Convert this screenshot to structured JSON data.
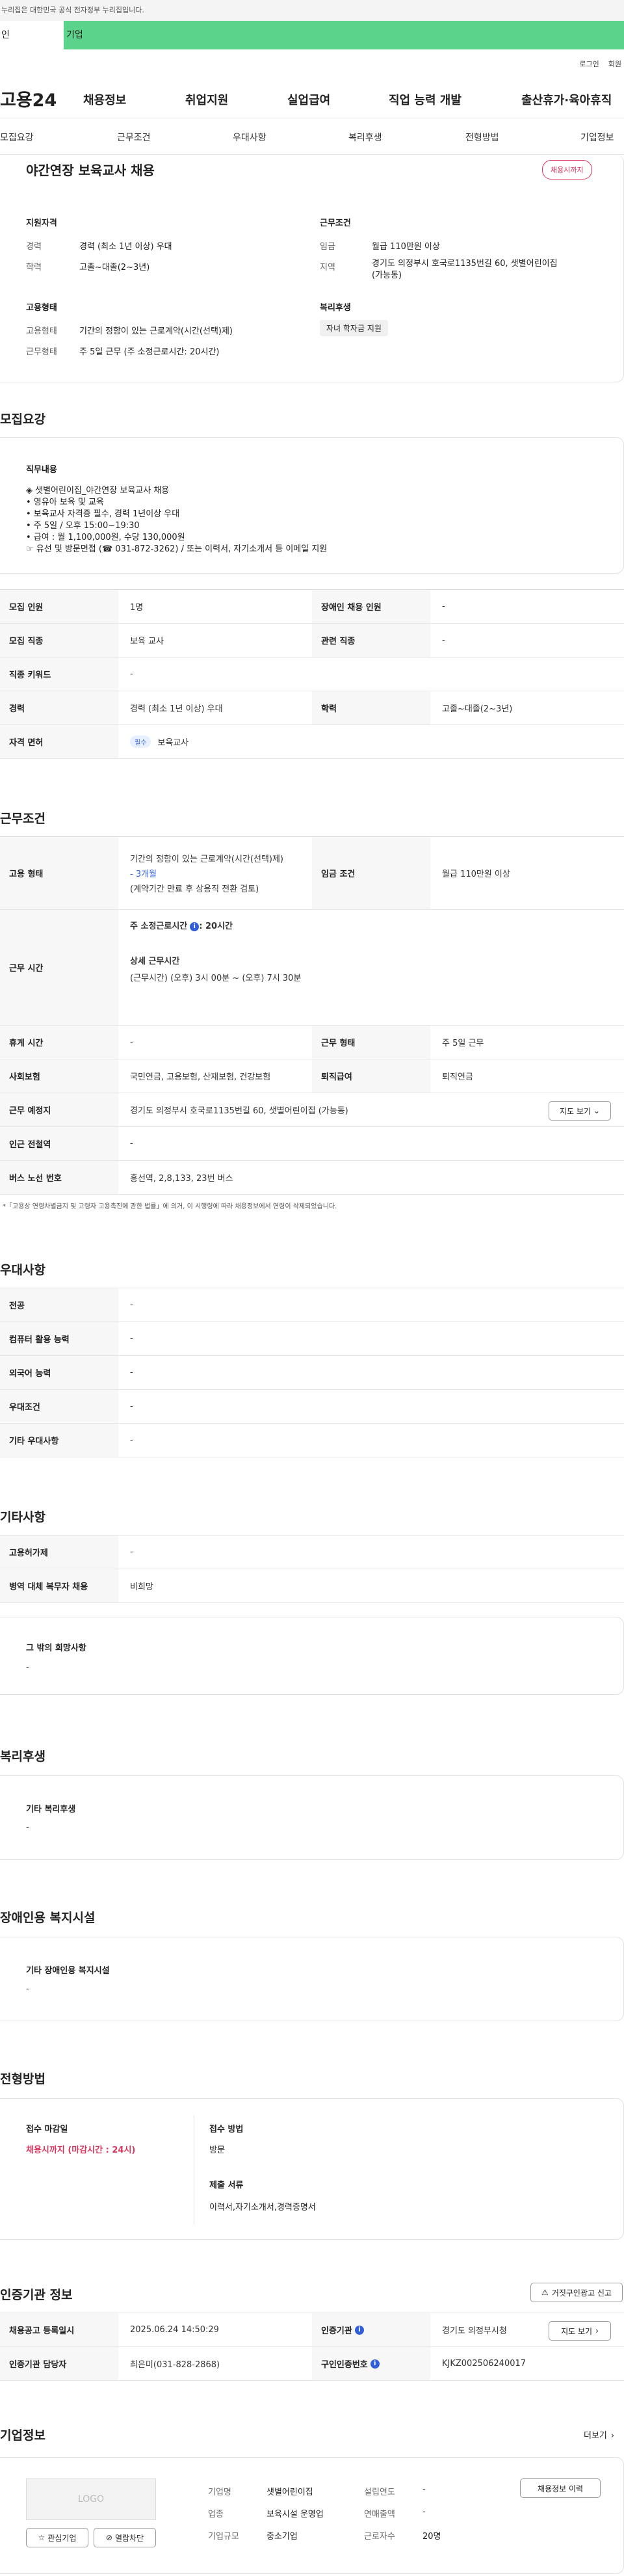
{
  "gov_notice": "누리집은 대한민국 공식 전자정부 누리집입니다.",
  "top_tabs": [
    "인",
    "기업"
  ],
  "util_links": [
    "로그인",
    "회원"
  ],
  "logo": "고용24",
  "gnb": [
    "채용정보",
    "취업지원",
    "실업급여",
    "직업 능력 개발",
    "출산휴가·육아휴직"
  ],
  "snb": [
    "모집요강",
    "근무조건",
    "우대사항",
    "복리후생",
    "전형방법",
    "기업정보"
  ],
  "summary": {
    "title": "야간연장 보육교사 채용",
    "deadline_badge": "채용시까지",
    "qual_heading": "지원자격",
    "qual": [
      {
        "k": "경력",
        "v": "경력 (최소 1년 이상) 우대"
      },
      {
        "k": "학력",
        "v": "고졸~대졸(2~3년)"
      }
    ],
    "cond_heading": "근무조건",
    "cond": [
      {
        "k": "임금",
        "v": "월급 110만원 이상"
      },
      {
        "k": "지역",
        "v": "경기도 의정부시 호국로1135번길 60, 샛별어린이집",
        "v2": "(가능동)"
      }
    ],
    "emp_heading": "고용형태",
    "emp": [
      {
        "k": "고용형태",
        "v": "기간의 정함이 있는 근로계약(시간(선택)제)"
      },
      {
        "k": "근무형태",
        "v": "주 5일 근무 (주 소정근로시간: 20시간)"
      }
    ],
    "welfare_heading": "복리후생",
    "welfare_tag": "자녀 학자금 지원"
  },
  "recruit": {
    "title": "모집요강",
    "duty_title": "직무내용",
    "duty_lines": [
      "◈ 샛별어린이집_야간연장 보육교사 채용",
      "• 영유아 보육 및 교육",
      "• 보육교사 자격증 필수, 경력 1년이상 우대",
      "• 주 5일 / 오후 15:00~19:30",
      "• 급여 : 월 1,100,000원, 수당 130,000원",
      "☞ 유선 및 방문면접 (☎ 031-872-3262) / 또는 이력서, 자기소개서 등 이메일 지원"
    ],
    "rows": [
      {
        "k1": "모집 인원",
        "v1": "1명",
        "k2": "장애인 채용 인원",
        "v2": "-"
      },
      {
        "k1": "모집 직종",
        "v1": "보육 교사",
        "k2": "관련 직종",
        "v2": "-"
      },
      {
        "k1": "직종 키워드",
        "v1": "-"
      },
      {
        "k1": "경력",
        "v1": "경력 (최소 1년 이상) 우대",
        "k2": "학력",
        "v2": "고졸~대졸(2~3년)"
      },
      {
        "k1": "자격 면허",
        "badge": "필수",
        "v1": "보육교사"
      }
    ]
  },
  "condition": {
    "title": "근무조건",
    "emp_k": "고용 형태",
    "emp_v1": "기간의 정함이 있는 근로계약(시간(선택)제)",
    "emp_v2": "- 3개월",
    "emp_v3": "(계약기간 만료 후 상용직 전환 검토)",
    "wage_k": "임금 조건",
    "wage_v": "월급 110만원 이상",
    "time_k": "근무 시간",
    "time_a": "주 소정근로시간",
    "time_a2": ": 20시간",
    "time_b": "상세 근무시간",
    "time_c": "(근무시간) (오후) 3시 00분 ~ (오후) 7시 30분",
    "rows": [
      {
        "k1": "휴게 시간",
        "v1": "-",
        "k2": "근무 형태",
        "v2": "주 5일 근무"
      },
      {
        "k1": "사회보험",
        "v1": "국민연금, 고용보험, 산재보험, 건강보험",
        "k2": "퇴직급여",
        "v2": "퇴직연금"
      },
      {
        "k1": "근무 예정지",
        "v1": "경기도 의정부시 호국로1135번길 60, 샛별어린이집 (가능동)",
        "btn": "지도 보기"
      },
      {
        "k1": "인근 전철역",
        "v1": "-"
      },
      {
        "k1": "버스 노선 번호",
        "v1": "흥선역, 2,8,133, 23번 버스"
      }
    ],
    "note": "*「고용상 연령차별금지 및 고령자 고용촉진에 관한 법률」에 의거, 이 시행령에 따라 채용정보에서 연령이 삭제되었습니다."
  },
  "pref": {
    "title": "우대사항",
    "rows": [
      {
        "k": "전공",
        "v": "-"
      },
      {
        "k": "컴퓨터 활용 능력",
        "v": "-"
      },
      {
        "k": "외국어 능력",
        "v": "-"
      },
      {
        "k": "우대조건",
        "v": "-"
      },
      {
        "k": "기타 우대사항",
        "v": "-"
      }
    ]
  },
  "etc": {
    "title": "기타사항",
    "rows": [
      {
        "k": "고용허가제",
        "v": "-"
      },
      {
        "k": "병역 대체 복무자 채용",
        "v": "비희망"
      }
    ],
    "box_title": "그 밖의 희망사항",
    "box_v": "-"
  },
  "benefit": {
    "title": "복리후생",
    "box_title": "기타 복리후생",
    "box_v": "-"
  },
  "facility": {
    "title": "장애인용 복지시설",
    "box_title": "기타 장애인용 복지시설",
    "box_v": "-"
  },
  "selection": {
    "title": "전형방법",
    "deadline_k": "접수 마감일",
    "deadline_v": "채용시까지 (마감시간 : 24시)",
    "method_k": "접수 방법",
    "method_v": "방문",
    "docs_k": "제출 서류",
    "docs_v": "이력서,자기소개서,경력증명서"
  },
  "cert": {
    "title": "인증기관 정보",
    "report_btn": "거짓구인광고 신고",
    "r1k1": "채용공고 등록일시",
    "r1v1": "2025.06.24 14:50:29",
    "r1k2": "인증기관",
    "r1v2": "경기도 의정부시청",
    "r1btn": "지도 보기",
    "r2k1": "인증기관 담당자",
    "r2v1": "최은미(031-828-2868)",
    "r2k2": "구인인증번호",
    "r2v2": "KJKZ002506240017"
  },
  "company": {
    "title": "기업정보",
    "more": "더보기",
    "logo_text": "LOGO",
    "fav_btn": "관심기업",
    "block_btn": "열람차단",
    "f": [
      {
        "k": "기업명",
        "v": "샛별어린이집"
      },
      {
        "k": "업종",
        "v": "보육시설 운영업"
      },
      {
        "k": "기업규모",
        "v": "중소기업"
      }
    ],
    "g": [
      {
        "k": "설립연도",
        "v": "-"
      },
      {
        "k": "연매출액",
        "v": "-"
      },
      {
        "k": "근로자수",
        "v": "20명"
      }
    ],
    "history_btn": "채용정보 이력"
  }
}
